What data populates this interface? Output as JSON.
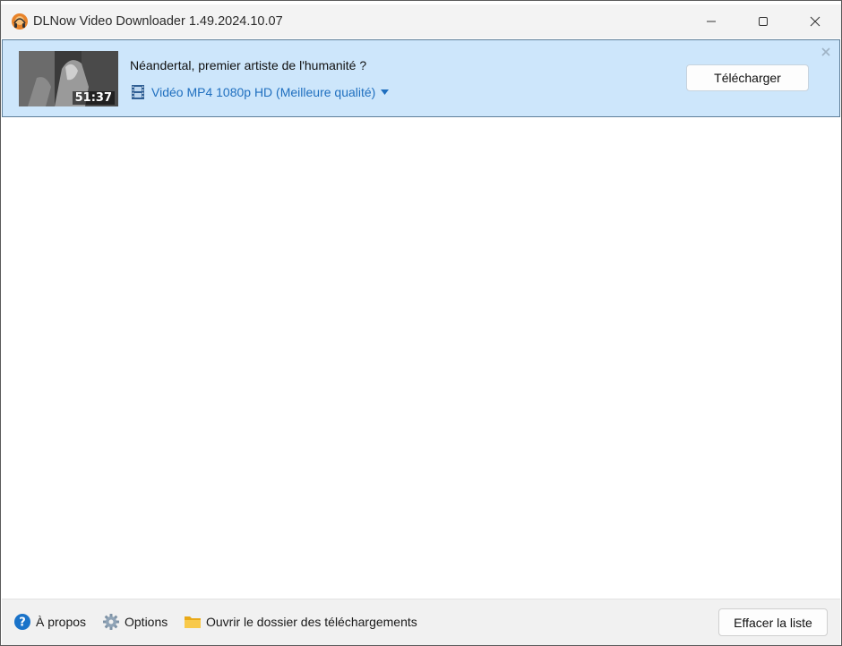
{
  "window": {
    "title": "DLNow Video Downloader 1.49.2024.10.07",
    "controls": [
      "minimize-icon",
      "maximize-icon",
      "close-icon"
    ]
  },
  "item": {
    "title": "Néandertal, premier artiste de l'humanité ?",
    "duration": "51:37",
    "format": "Vidéo MP4 1080p HD (Meilleure qualité)",
    "download_label": "Télécharger"
  },
  "footer": {
    "about_label": "À propos",
    "options_label": "Options",
    "open_folder_label": "Ouvrir le dossier des téléchargements",
    "clear_label": "Effacer la liste"
  },
  "colors": {
    "item_background": "#cde6fb",
    "link_blue": "#1f6fbf",
    "titlebar": "#f3f3f3",
    "footer": "#f1f1f1"
  }
}
